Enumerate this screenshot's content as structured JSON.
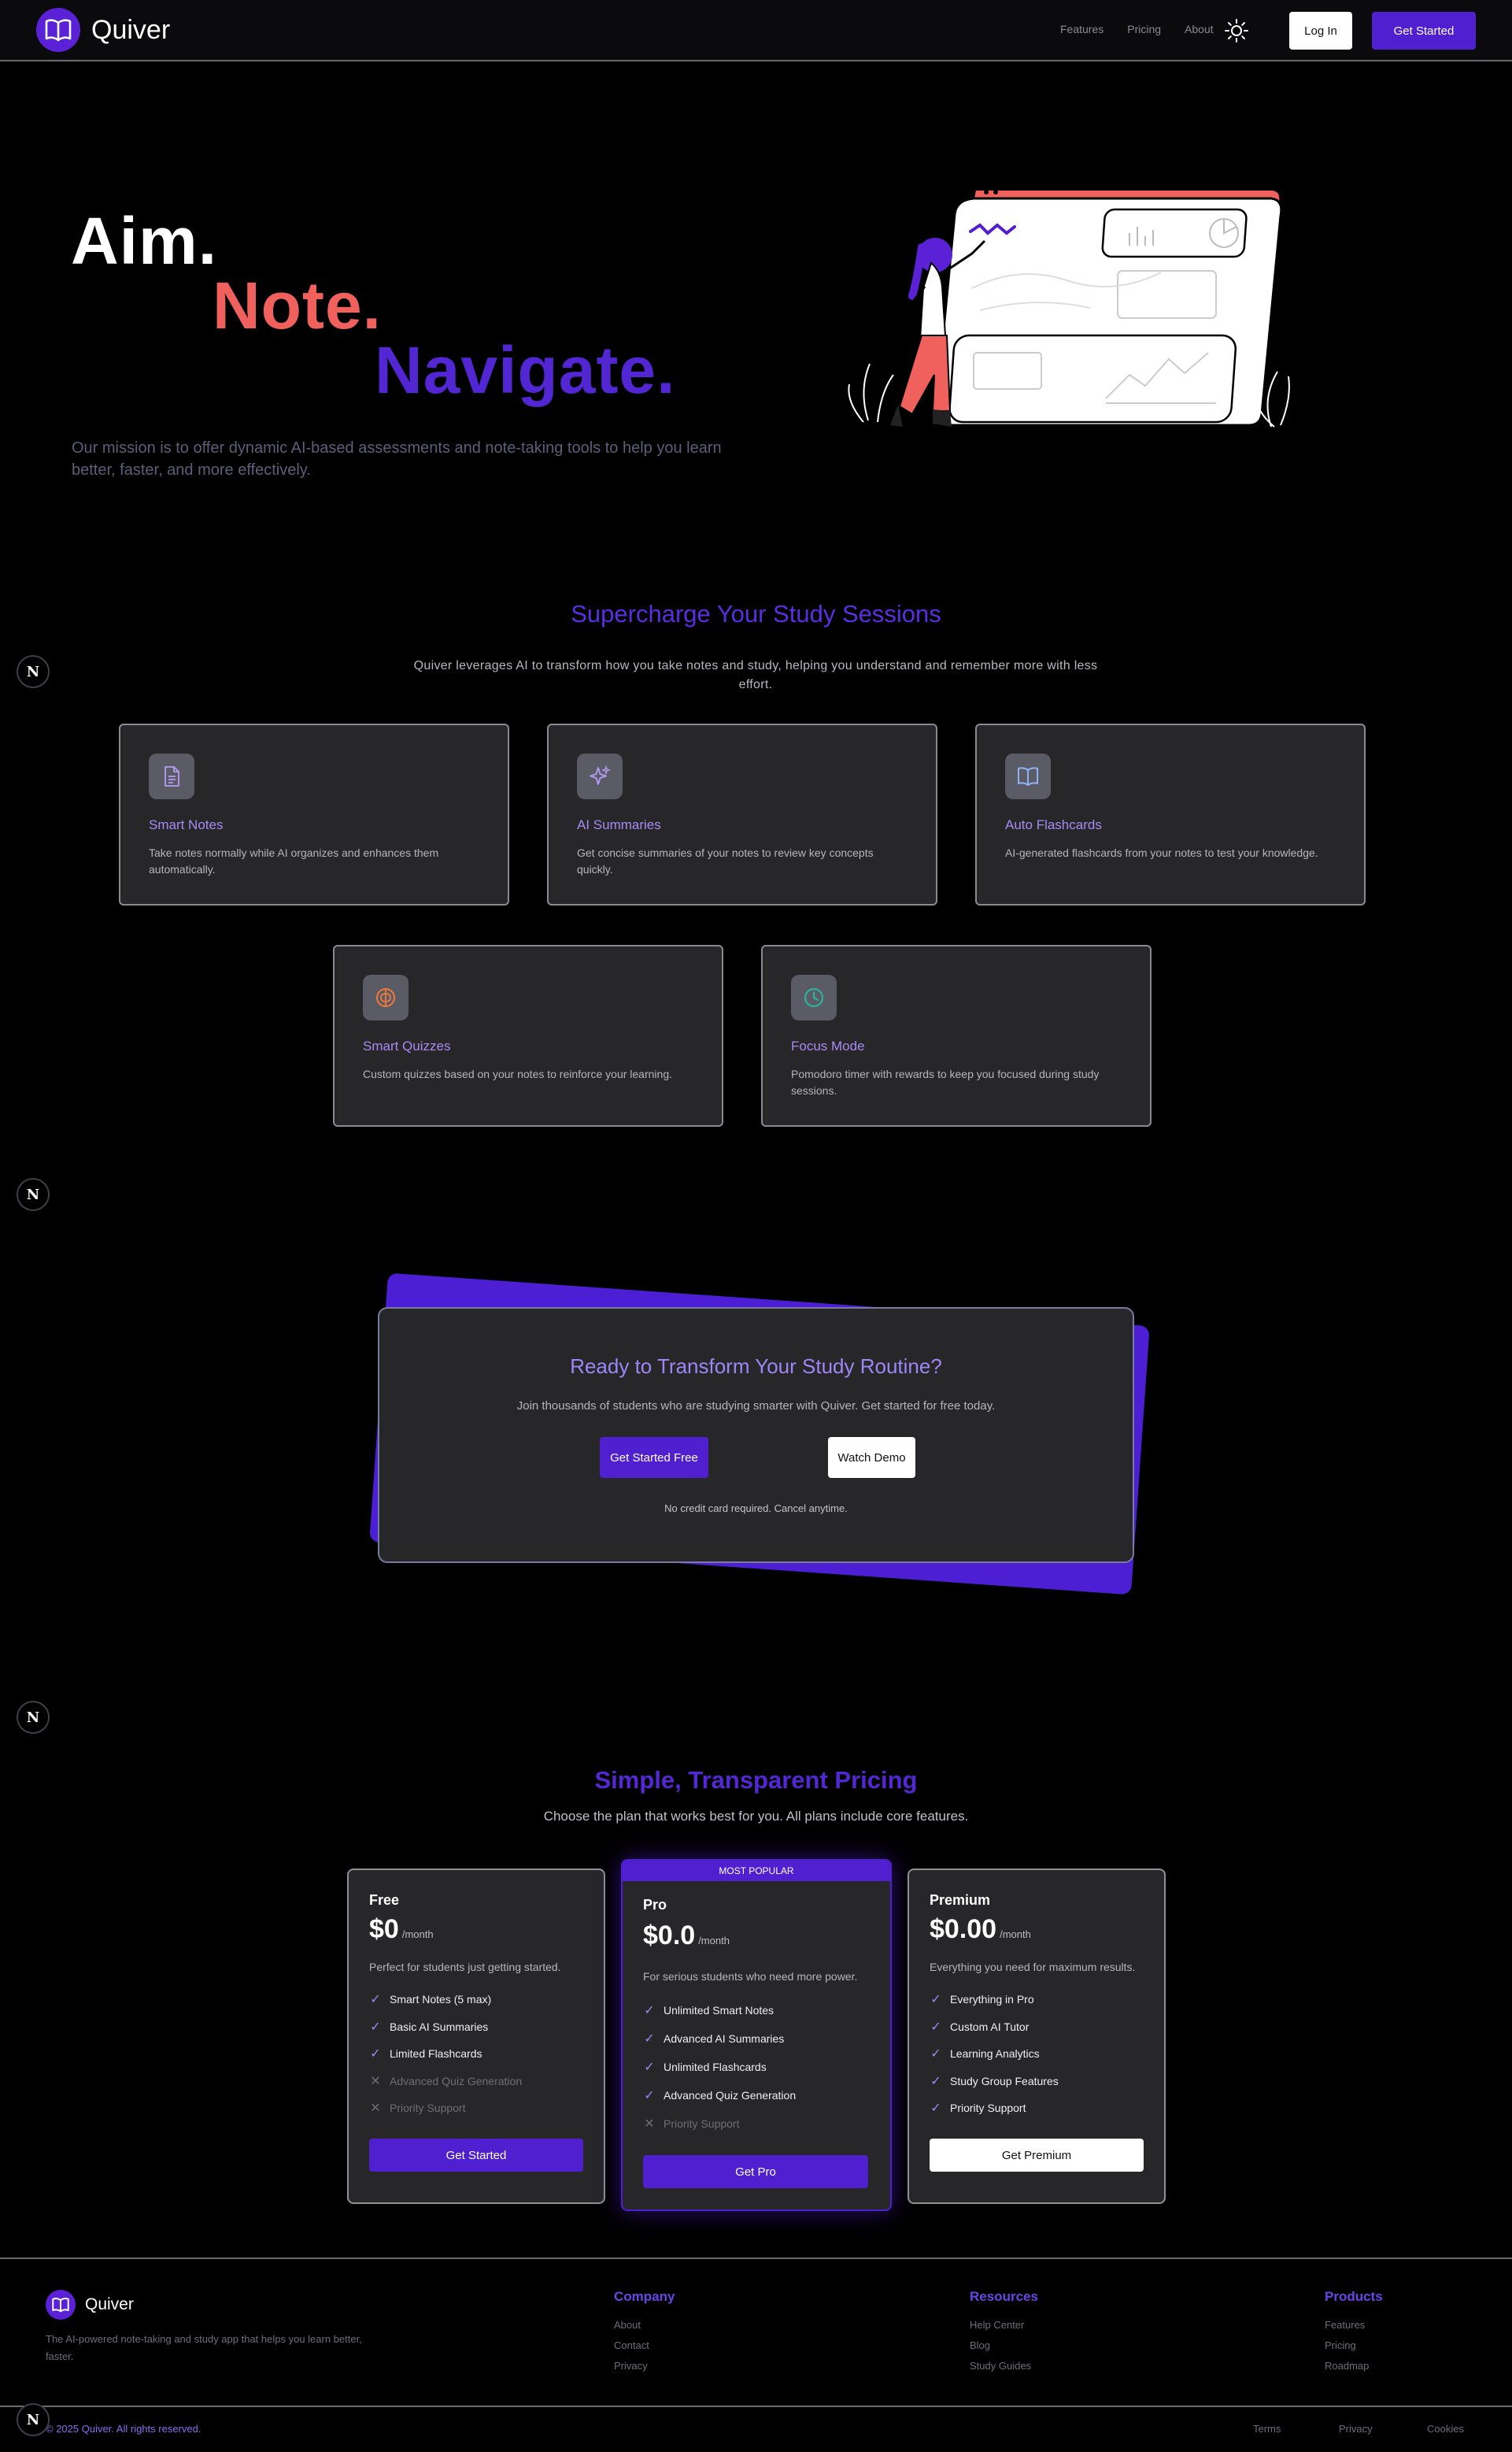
{
  "nav": {
    "brand": "Quiver",
    "links": [
      "Features",
      "Pricing",
      "About"
    ],
    "login": "Log In",
    "get_started": "Get Started"
  },
  "hero": {
    "line1": "Aim.",
    "line2": "Note.",
    "line3": "Navigate.",
    "mission": "Our mission is to offer dynamic AI-based assessments and note-taking tools to help you learn better, faster, and more effectively."
  },
  "features": {
    "title": "Supercharge Your Study Sessions",
    "subtitle": "Quiver leverages AI to transform how you take notes and study, helping you understand and remember more with less effort.",
    "cards": [
      {
        "title": "Smart Notes",
        "desc": "Take notes normally while AI organizes and enhances them automatically.",
        "icon": "document-icon"
      },
      {
        "title": "AI Summaries",
        "desc": "Get concise summaries of your notes to review key concepts quickly.",
        "icon": "sparkles-icon"
      },
      {
        "title": "Auto Flashcards",
        "desc": "AI-generated flashcards from your notes to test your knowledge.",
        "icon": "open-book-icon"
      },
      {
        "title": "Smart Quizzes",
        "desc": "Custom quizzes based on your notes to reinforce your learning.",
        "icon": "brain-icon"
      },
      {
        "title": "Focus Mode",
        "desc": "Pomodoro timer with rewards to keep you focused during study sessions.",
        "icon": "clock-icon"
      }
    ]
  },
  "cta": {
    "title": "Ready to Transform Your Study Routine?",
    "subtitle": "Join thousands of students who are studying smarter with Quiver. Get started for free today.",
    "primary": "Get Started Free",
    "secondary": "Watch Demo",
    "note": "No credit card required. Cancel anytime."
  },
  "pricing": {
    "title": "Simple, Transparent Pricing",
    "subtitle": "Choose the plan that works best for you. All plans include core features.",
    "per": "/month",
    "badge": "MOST POPULAR",
    "plans": [
      {
        "name": "Free",
        "price": "$0",
        "desc": "Perfect for students just getting started.",
        "features": [
          {
            "label": "Smart Notes (5 max)",
            "included": true
          },
          {
            "label": "Basic AI Summaries",
            "included": true
          },
          {
            "label": "Limited Flashcards",
            "included": true
          },
          {
            "label": "Advanced Quiz Generation",
            "included": false
          },
          {
            "label": "Priority Support",
            "included": false
          }
        ],
        "button": "Get Started"
      },
      {
        "name": "Pro",
        "price": "$0.0",
        "desc": "For serious students who need more power.",
        "features": [
          {
            "label": "Unlimited Smart Notes",
            "included": true
          },
          {
            "label": "Advanced AI Summaries",
            "included": true
          },
          {
            "label": "Unlimited Flashcards",
            "included": true
          },
          {
            "label": "Advanced Quiz Generation",
            "included": true
          },
          {
            "label": "Priority Support",
            "included": false
          }
        ],
        "button": "Get Pro"
      },
      {
        "name": "Premium",
        "price": "$0.00",
        "desc": "Everything you need for maximum results.",
        "features": [
          {
            "label": "Everything in Pro",
            "included": true
          },
          {
            "label": "Custom AI Tutor",
            "included": true
          },
          {
            "label": "Learning Analytics",
            "included": true
          },
          {
            "label": "Study Group Features",
            "included": true
          },
          {
            "label": "Priority Support",
            "included": true
          }
        ],
        "button": "Get Premium"
      }
    ]
  },
  "badge_letter": "N",
  "footer": {
    "brand": "Quiver",
    "desc": "The AI-powered note-taking and study app that helps you learn better, faster.",
    "columns": [
      {
        "title": "Company",
        "links": [
          "About",
          "Contact",
          "Privacy"
        ]
      },
      {
        "title": "Resources",
        "links": [
          "Help Center",
          "Blog",
          "Study Guides"
        ]
      },
      {
        "title": "Products",
        "links": [
          "Features",
          "Pricing",
          "Roadmap"
        ]
      }
    ],
    "copyright": "© 2025 Quiver. All rights reserved.",
    "legal": [
      "Terms",
      "Privacy",
      "Cookies"
    ]
  },
  "colors": {
    "accent": "#4f1fd0",
    "coral": "#f0615d",
    "lavender": "#a68bf5"
  }
}
